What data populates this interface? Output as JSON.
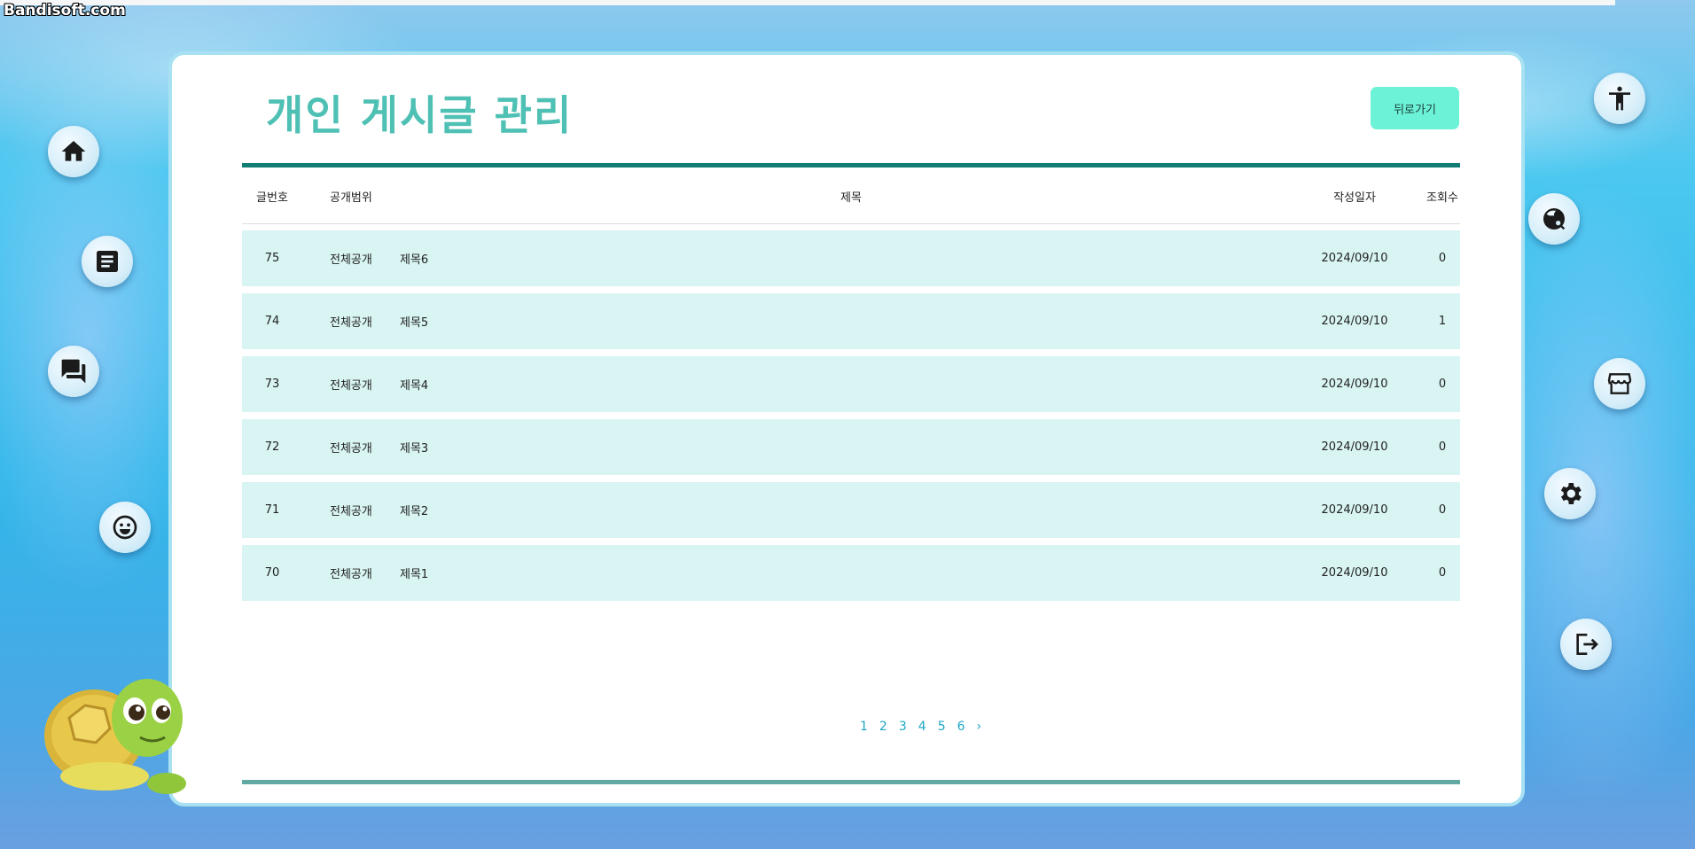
{
  "watermark": "Bandisoft.com",
  "page": {
    "title": "개인 게시글 관리",
    "back_label": "뒤로가기"
  },
  "table": {
    "headers": {
      "number": "글번호",
      "scope": "공개범위",
      "title": "제목",
      "date": "작성일자",
      "views": "조회수"
    },
    "rows": [
      {
        "number": "75",
        "scope": "전체공개",
        "title": "제목6",
        "date": "2024/09/10",
        "views": "0"
      },
      {
        "number": "74",
        "scope": "전체공개",
        "title": "제목5",
        "date": "2024/09/10",
        "views": "1"
      },
      {
        "number": "73",
        "scope": "전체공개",
        "title": "제목4",
        "date": "2024/09/10",
        "views": "0"
      },
      {
        "number": "72",
        "scope": "전체공개",
        "title": "제목3",
        "date": "2024/09/10",
        "views": "0"
      },
      {
        "number": "71",
        "scope": "전체공개",
        "title": "제목2",
        "date": "2024/09/10",
        "views": "0"
      },
      {
        "number": "70",
        "scope": "전체공개",
        "title": "제목1",
        "date": "2024/09/10",
        "views": "0"
      }
    ]
  },
  "pagination": {
    "pages": [
      "1",
      "2",
      "3",
      "4",
      "5",
      "6"
    ],
    "next": "›"
  },
  "sidebar_left": [
    "home-icon",
    "article-icon",
    "chat-icon",
    "smiley-icon"
  ],
  "sidebar_right": [
    "accessibility-icon",
    "travel-explore-icon",
    "store-icon",
    "gear-icon",
    "logout-icon"
  ],
  "colors": {
    "title": "#4fc0b4",
    "back_button": "#6cf2d6",
    "rule_top": "#107c74",
    "row_bg": "#d8f4f3",
    "page_link": "#1ea6c4"
  }
}
